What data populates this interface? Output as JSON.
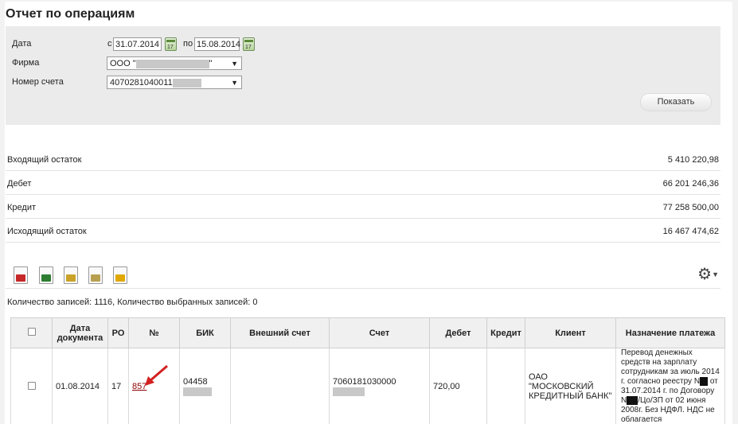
{
  "title": "Отчет по операциям",
  "filter": {
    "date_label": "Дата",
    "from_prefix": "с",
    "date_from": "31.07.2014",
    "to_prefix": "по",
    "date_to": "15.08.2014",
    "calendar_day": "17",
    "firm_label": "Фирма",
    "firm_value_prefix": "ООО \"",
    "firm_value_suffix": "\"",
    "account_label": "Номер счета",
    "account_value": "4070281040011",
    "show_button": "Показать"
  },
  "summary": [
    {
      "label": "Входящий остаток",
      "value": "5 410 220,98"
    },
    {
      "label": "Дебет",
      "value": "66 201 246,36"
    },
    {
      "label": "Кредит",
      "value": "77 258 500,00"
    },
    {
      "label": "Исходящий остаток",
      "value": "16 467 474,62"
    }
  ],
  "toolbar": {
    "icons": [
      "pdf-export-icon",
      "excel-export-icon",
      "pdf-folder-icon",
      "doc-folder-icon",
      "document-export-icon"
    ],
    "icon_colors": [
      "#c62828",
      "#2e7d32",
      "#caa227",
      "#b8a050",
      "#e0a800"
    ]
  },
  "count_text": "Количество записей: 1116, Количество выбранных записей: 0",
  "table": {
    "headers": [
      "",
      "Дата документа",
      "РО",
      "№",
      "БИК",
      "Внешний счет",
      "Счет",
      "Дебет",
      "Кредит",
      "Клиент",
      "Назначение платежа"
    ],
    "row": {
      "date": "01.08.2014",
      "ro": "17",
      "number": "857",
      "bik": "04458",
      "external_account": "",
      "account": "7060181030000",
      "debit": "720,00",
      "credit": "",
      "client": "ОАО \"МОСКОВСКИЙ КРЕДИТНЫЙ БАНК\"",
      "purpose_1": "Перевод денежных средств на зарплату сотрудникам за июль 2014 г. согласно реестру N",
      "purpose_2": " от 31.07.2014 г. по Договору N",
      "purpose_3": "/Цо/ЗП от ",
      "purpose_4": "02 июня 2008г. Без НДФЛ. НДС не облагается"
    }
  }
}
